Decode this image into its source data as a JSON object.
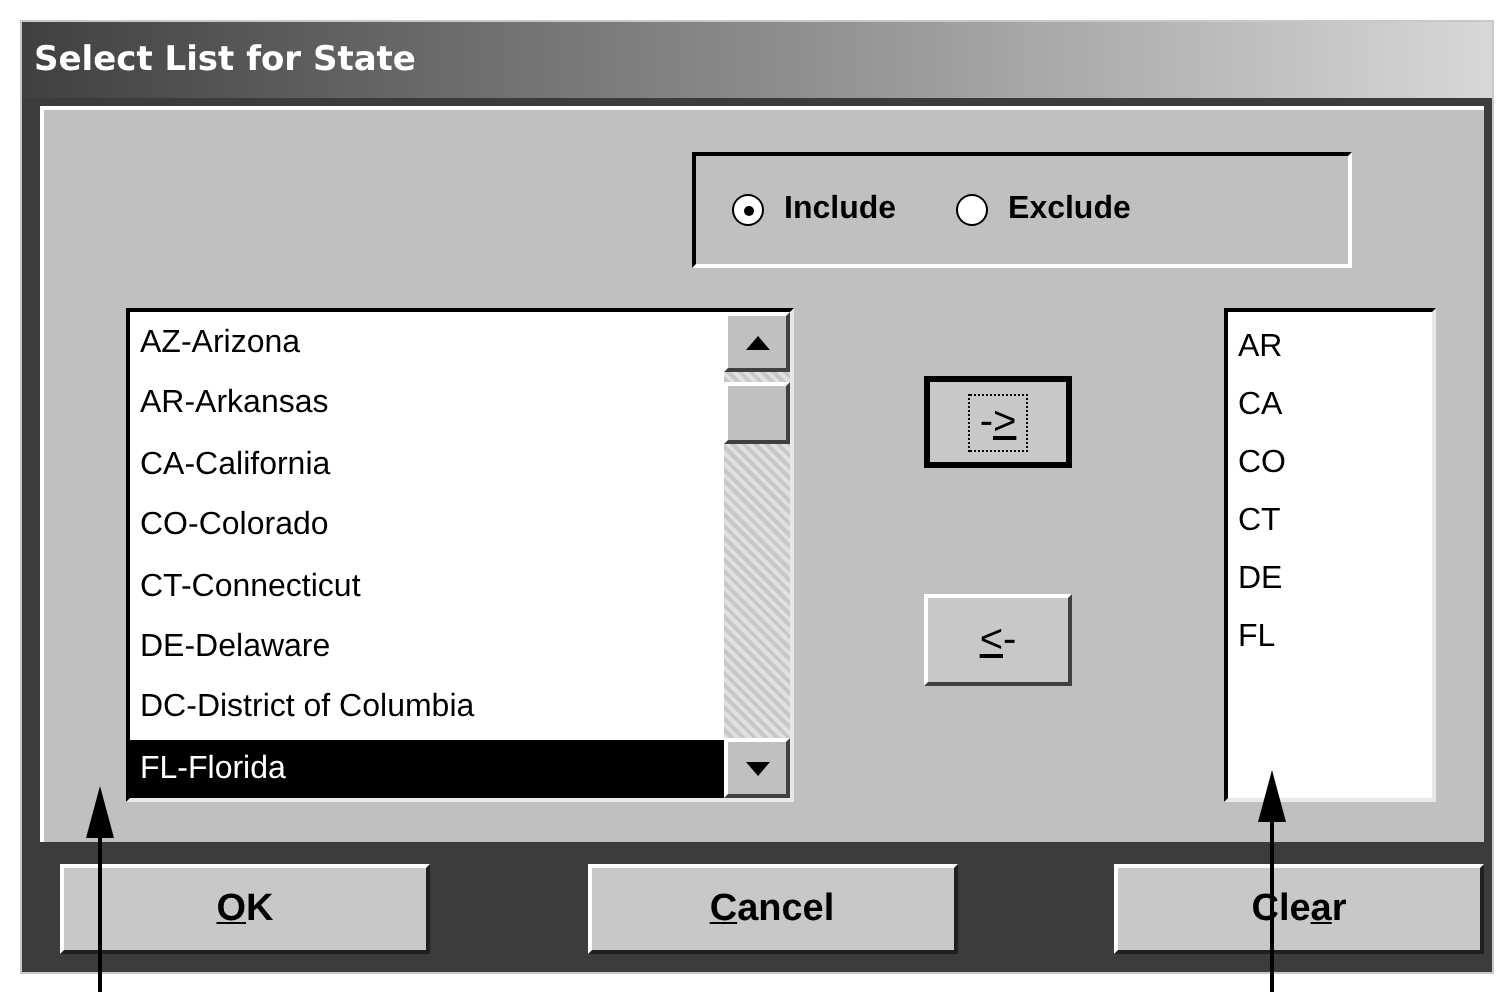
{
  "window": {
    "title": "Select List for State"
  },
  "mode_options": [
    {
      "label": "Include",
      "selected": true
    },
    {
      "label": "Exclude",
      "selected": false
    }
  ],
  "available_list": {
    "items": [
      {
        "label": "AZ-Arizona",
        "selected": false
      },
      {
        "label": "AR-Arkansas",
        "selected": false
      },
      {
        "label": "CA-California",
        "selected": false
      },
      {
        "label": "CO-Colorado",
        "selected": false
      },
      {
        "label": "CT-Connecticut",
        "selected": false
      },
      {
        "label": "DE-Delaware",
        "selected": false
      },
      {
        "label": "DC-District of Columbia",
        "selected": false
      },
      {
        "label": "FL-Florida",
        "selected": true
      }
    ]
  },
  "move_buttons": [
    {
      "pre": "-",
      "key": ">",
      "focused": true
    },
    {
      "key": "<",
      "post": "-",
      "focused": false
    }
  ],
  "selected_list": {
    "items": [
      "AR",
      "CA",
      "CO",
      "CT",
      "DE",
      "FL"
    ]
  },
  "buttons": [
    {
      "key": "O",
      "post": "K"
    },
    {
      "key": "C",
      "post": "ancel"
    },
    {
      "pre": "Cle",
      "key": "a",
      "post": "r"
    }
  ]
}
